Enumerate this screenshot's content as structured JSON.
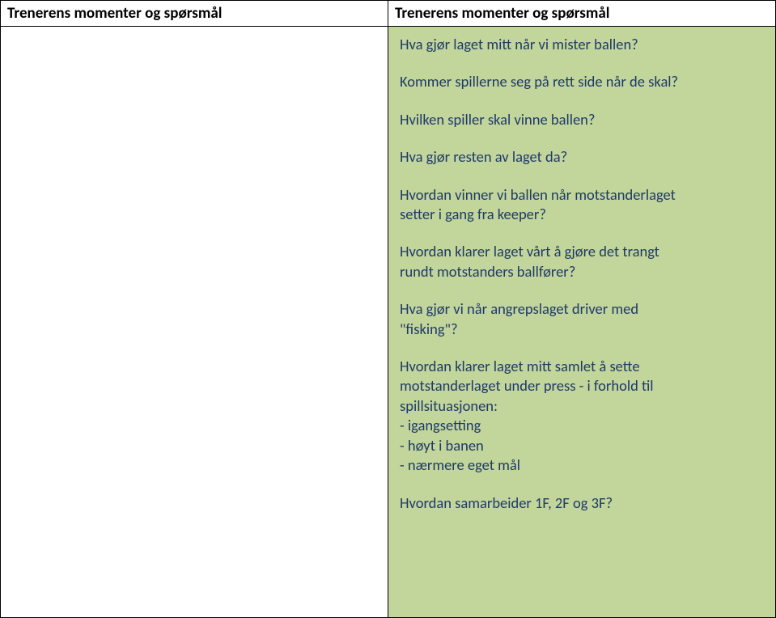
{
  "table": {
    "header_left": "Trenerens momenter og spørsmål",
    "header_right": "Trenerens momenter og spørsmål"
  },
  "questions": {
    "q1": "Hva gjør laget mitt når vi mister ballen?",
    "q2": "Kommer spillerne seg på rett side når de skal?",
    "q3": "Hvilken spiller skal vinne ballen?",
    "q4": "Hva gjør resten av laget da?",
    "q5_line1": "Hvordan vinner vi ballen når motstanderlaget",
    "q5_line2": "setter i gang fra keeper?",
    "q6_line1": "Hvordan klarer laget vårt å gjøre det trangt",
    "q6_line2": "rundt motstanders ballfører?",
    "q7_line1": "Hva gjør vi når angrepslaget driver med",
    "q7_line2": "\"fisking\"?",
    "q8_line1": "Hvordan klarer laget mitt samlet å sette",
    "q8_line2": "motstanderlaget under press - i forhold til",
    "q8_line3": "spillsituasjonen:",
    "q8_bullet1": "- igangsetting",
    "q8_bullet2": "- høyt i banen",
    "q8_bullet3": "- nærmere eget mål",
    "q9": "Hvordan samarbeider 1F, 2F og 3F?"
  }
}
